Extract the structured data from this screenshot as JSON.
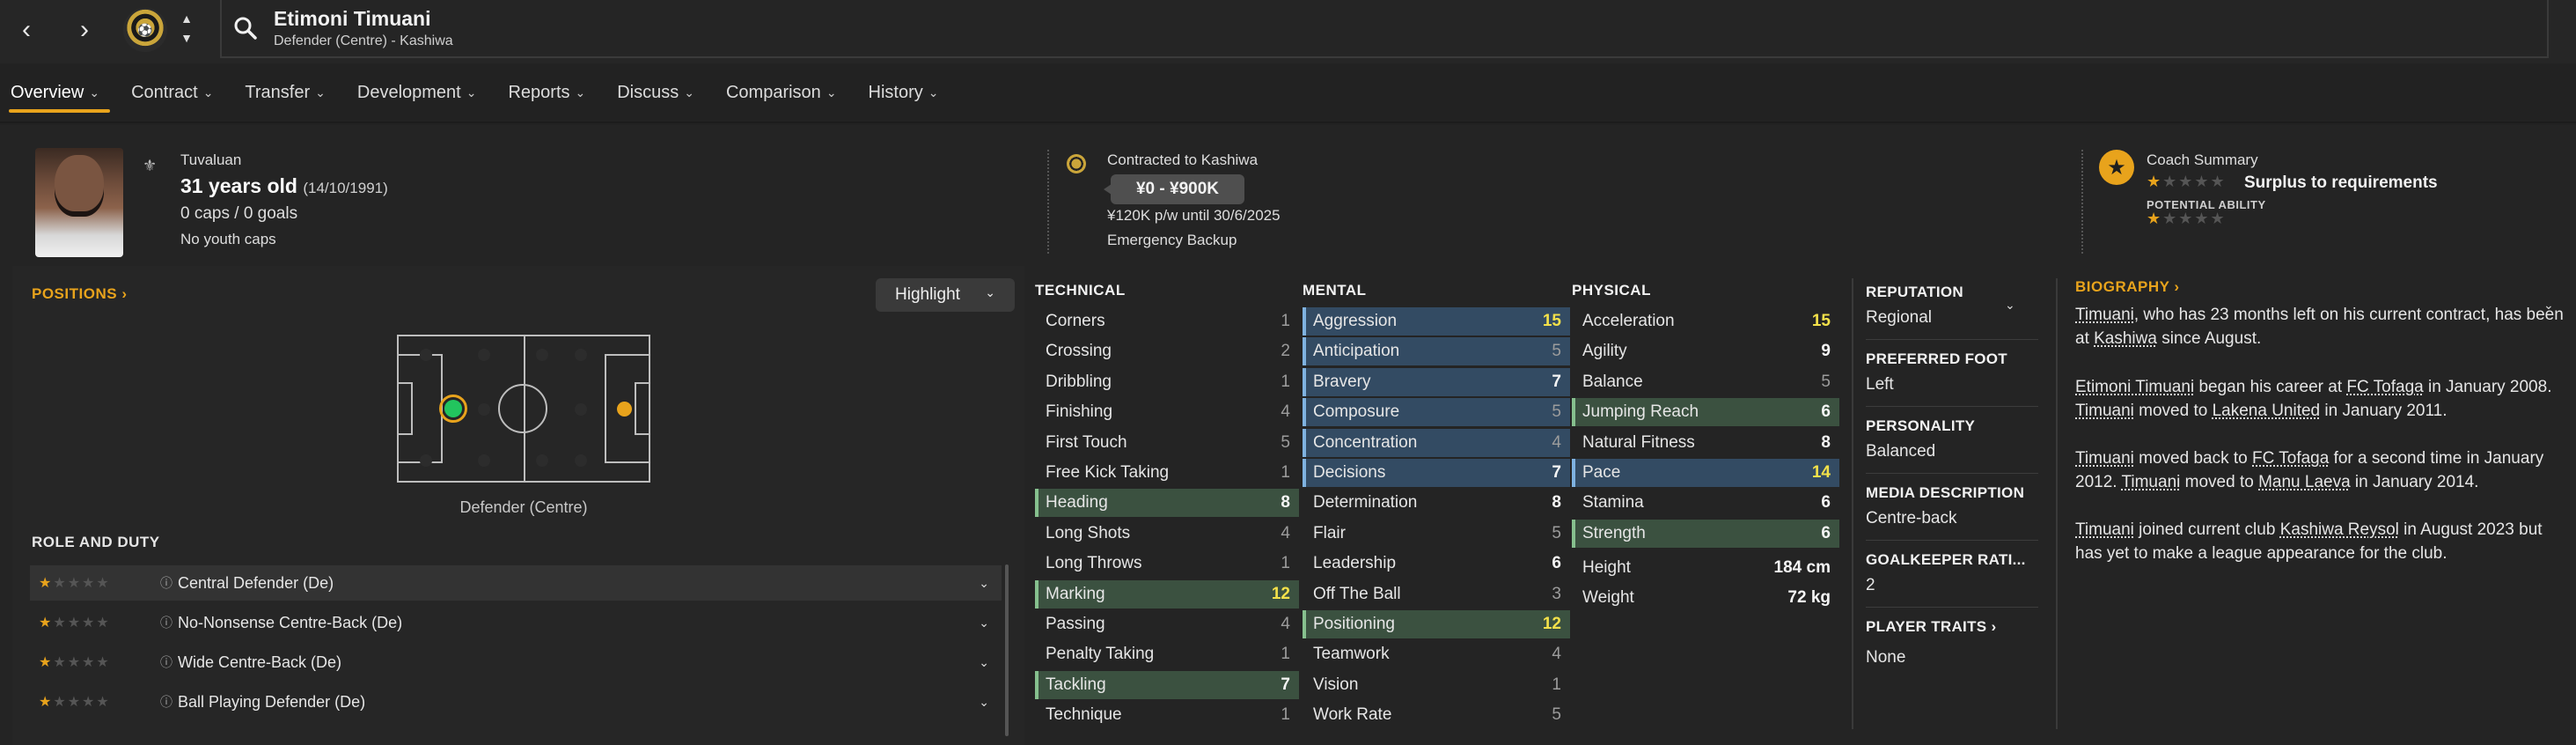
{
  "header": {
    "player_name": "Etimoni Timuani",
    "player_subtitle": "Defender (Centre) - Kashiwa",
    "back_icon": "chevron-left-icon",
    "forward_icon": "chevron-right-icon",
    "club_badge_icon": "kashiwa-badge-icon",
    "search_icon": "search-icon"
  },
  "tabs": [
    {
      "label": "Overview",
      "active": true
    },
    {
      "label": "Contract"
    },
    {
      "label": "Transfer"
    },
    {
      "label": "Development"
    },
    {
      "label": "Reports"
    },
    {
      "label": "Discuss"
    },
    {
      "label": "Comparison"
    },
    {
      "label": "History"
    }
  ],
  "profile": {
    "nationality": "Tuvaluan",
    "age": "31 years old",
    "dob": "(14/10/1991)",
    "caps": "0 caps / 0 goals",
    "youth_caps": "No youth caps"
  },
  "contract": {
    "label": "Contracted to Kashiwa",
    "value_range": "¥0 - ¥900K",
    "wage": "¥120K p/w until 30/6/2025",
    "squad_status": "Emergency Backup"
  },
  "coach": {
    "label": "Coach Summary",
    "summary": "Surplus to requirements",
    "potential_label": "POTENTIAL ABILITY",
    "current_ability_stars": 0.5,
    "potential_ability_stars": 0.5
  },
  "positions": {
    "title": "POSITIONS",
    "highlight_label": "Highlight",
    "pitch_label": "Defender (Centre)",
    "role_title": "ROLE AND DUTY",
    "roles": [
      {
        "name": "Central Defender (De)",
        "stars": 0.5
      },
      {
        "name": "No-Nonsense Centre-Back (De)",
        "stars": 0.5
      },
      {
        "name": "Wide Centre-Back (De)",
        "stars": 0.5
      },
      {
        "name": "Ball Playing Defender (De)",
        "stars": 0.5
      }
    ]
  },
  "attributes": {
    "technical": {
      "title": "TECHNICAL",
      "rows": [
        {
          "name": "Corners",
          "value": "1"
        },
        {
          "name": "Crossing",
          "value": "2"
        },
        {
          "name": "Dribbling",
          "value": "1"
        },
        {
          "name": "Finishing",
          "value": "4"
        },
        {
          "name": "First Touch",
          "value": "5"
        },
        {
          "name": "Free Kick Taking",
          "value": "1"
        },
        {
          "name": "Heading",
          "value": "8",
          "hl": "green"
        },
        {
          "name": "Long Shots",
          "value": "4"
        },
        {
          "name": "Long Throws",
          "value": "1"
        },
        {
          "name": "Marking",
          "value": "12",
          "hl": "green"
        },
        {
          "name": "Passing",
          "value": "4"
        },
        {
          "name": "Penalty Taking",
          "value": "1"
        },
        {
          "name": "Tackling",
          "value": "7",
          "hl": "green"
        },
        {
          "name": "Technique",
          "value": "1"
        }
      ]
    },
    "mental": {
      "title": "MENTAL",
      "rows": [
        {
          "name": "Aggression",
          "value": "15",
          "hl": "blue"
        },
        {
          "name": "Anticipation",
          "value": "5",
          "hl": "blue"
        },
        {
          "name": "Bravery",
          "value": "7",
          "hl": "blue"
        },
        {
          "name": "Composure",
          "value": "5",
          "hl": "blue"
        },
        {
          "name": "Concentration",
          "value": "4",
          "hl": "blue"
        },
        {
          "name": "Decisions",
          "value": "7",
          "hl": "blue"
        },
        {
          "name": "Determination",
          "value": "8"
        },
        {
          "name": "Flair",
          "value": "5"
        },
        {
          "name": "Leadership",
          "value": "6"
        },
        {
          "name": "Off The Ball",
          "value": "3"
        },
        {
          "name": "Positioning",
          "value": "12",
          "hl": "green"
        },
        {
          "name": "Teamwork",
          "value": "4"
        },
        {
          "name": "Vision",
          "value": "1"
        },
        {
          "name": "Work Rate",
          "value": "5"
        }
      ]
    },
    "physical": {
      "title": "PHYSICAL",
      "rows": [
        {
          "name": "Acceleration",
          "value": "15"
        },
        {
          "name": "Agility",
          "value": "9"
        },
        {
          "name": "Balance",
          "value": "5"
        },
        {
          "name": "Jumping Reach",
          "value": "6",
          "hl": "green"
        },
        {
          "name": "Natural Fitness",
          "value": "8"
        },
        {
          "name": "Pace",
          "value": "14",
          "hl": "blue"
        },
        {
          "name": "Stamina",
          "value": "6"
        },
        {
          "name": "Strength",
          "value": "6",
          "hl": "green"
        }
      ],
      "stats": [
        {
          "name": "Height",
          "value": "184 cm"
        },
        {
          "name": "Weight",
          "value": "72 kg"
        }
      ]
    }
  },
  "side": {
    "reputation_label": "REPUTATION",
    "reputation": "Regional",
    "foot_label": "PREFERRED FOOT",
    "foot": "Left",
    "personality_label": "PERSONALITY",
    "personality": "Balanced",
    "media_label": "MEDIA DESCRIPTION",
    "media": "Centre-back",
    "gk_label": "GOALKEEPER RATI...",
    "gk": "2",
    "traits_label": "PLAYER TRAITS",
    "traits": "None"
  },
  "biography": {
    "title": "BIOGRAPHY",
    "p1": [
      " ",
      "Timuani",
      ", who has 23 months left on his current contract, has been at ",
      "Kashiwa",
      " since August."
    ],
    "p2": [
      "Etimoni Timuani",
      " began his career at ",
      "FC Tofaga",
      " in January 2008. ",
      "Timuani",
      " moved to ",
      "Lakena United",
      " in January 2011."
    ],
    "p3": [
      "Timuani",
      " moved back to ",
      "FC Tofaga",
      " for a second time in January 2012. ",
      "Timuani",
      " moved to ",
      "Manu Laeva",
      " in January 2014."
    ],
    "p4": [
      "Timuani",
      " joined current club ",
      "Kashiwa Reysol",
      " in August 2023 but has yet to make a league appearance for the club."
    ]
  },
  "colors": {
    "accent": "#e8a31c",
    "highlight_green": "#3b5140",
    "highlight_blue": "#334b63",
    "value_yellow": "#f3e14a",
    "selected_position_dot": "#22c55e"
  }
}
